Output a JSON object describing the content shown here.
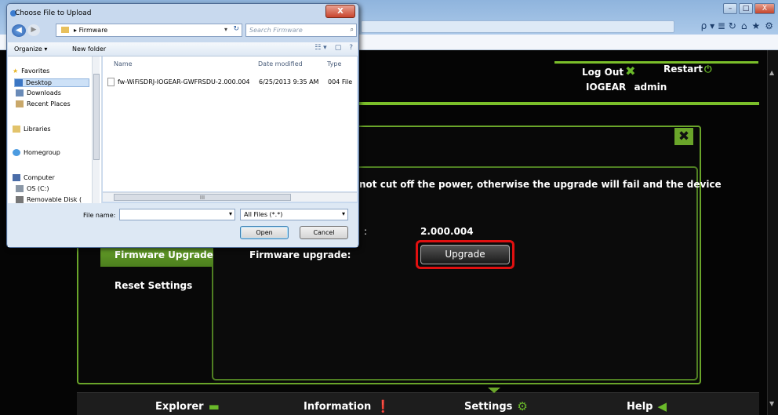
{
  "browser": {
    "controls": {
      "minimize": "–",
      "maximize": "□",
      "close": "X"
    },
    "tools": [
      "ρ ▾ ≣ ↻",
      "⌂",
      "★",
      "⚙"
    ]
  },
  "header": {
    "logout_label": "Log Out",
    "restart_label": "Restart",
    "brand": "IOGEAR",
    "user": "admin"
  },
  "settings_nav": {
    "firmware_upgrade": "Firmware Upgrade",
    "reset_settings": "Reset Settings"
  },
  "firmware": {
    "warning_text": "not cut off the power, otherwise the upgrade will fail and the device",
    "version_colon": ":",
    "version_value": "2.000.004",
    "upgrade_label": "Firmware upgrade:",
    "upgrade_button": "Upgrade"
  },
  "footer_tabs": [
    {
      "label": "Explorer"
    },
    {
      "label": "Information"
    },
    {
      "label": "Settings"
    },
    {
      "label": "Help"
    }
  ],
  "dialog": {
    "title": "Choose File to Upload",
    "path": "Firmware",
    "search_placeholder": "Search Firmware",
    "toolbar": {
      "organize": "Organize ▾",
      "new_folder": "New folder"
    },
    "nav_items": [
      {
        "label": "Favorites"
      },
      {
        "label": "Desktop"
      },
      {
        "label": "Downloads"
      },
      {
        "label": "Recent Places"
      },
      {
        "label": "Libraries"
      },
      {
        "label": "Homegroup"
      },
      {
        "label": "Computer"
      },
      {
        "label": "OS (C:)"
      },
      {
        "label": "Removable Disk ("
      }
    ],
    "columns": {
      "name": "Name",
      "date": "Date modified",
      "type": "Type"
    },
    "files": [
      {
        "name": "fw-WiFiSDRJ-IOGEAR-GWFRSDU-2.000.004",
        "date": "6/25/2013 9:35 AM",
        "type": "004 File"
      }
    ],
    "file_name_label": "File name:",
    "file_name_value": "",
    "file_type": "All Files (*.*)",
    "open_button": "Open",
    "cancel_button": "Cancel",
    "hscroll_grip": "III"
  }
}
